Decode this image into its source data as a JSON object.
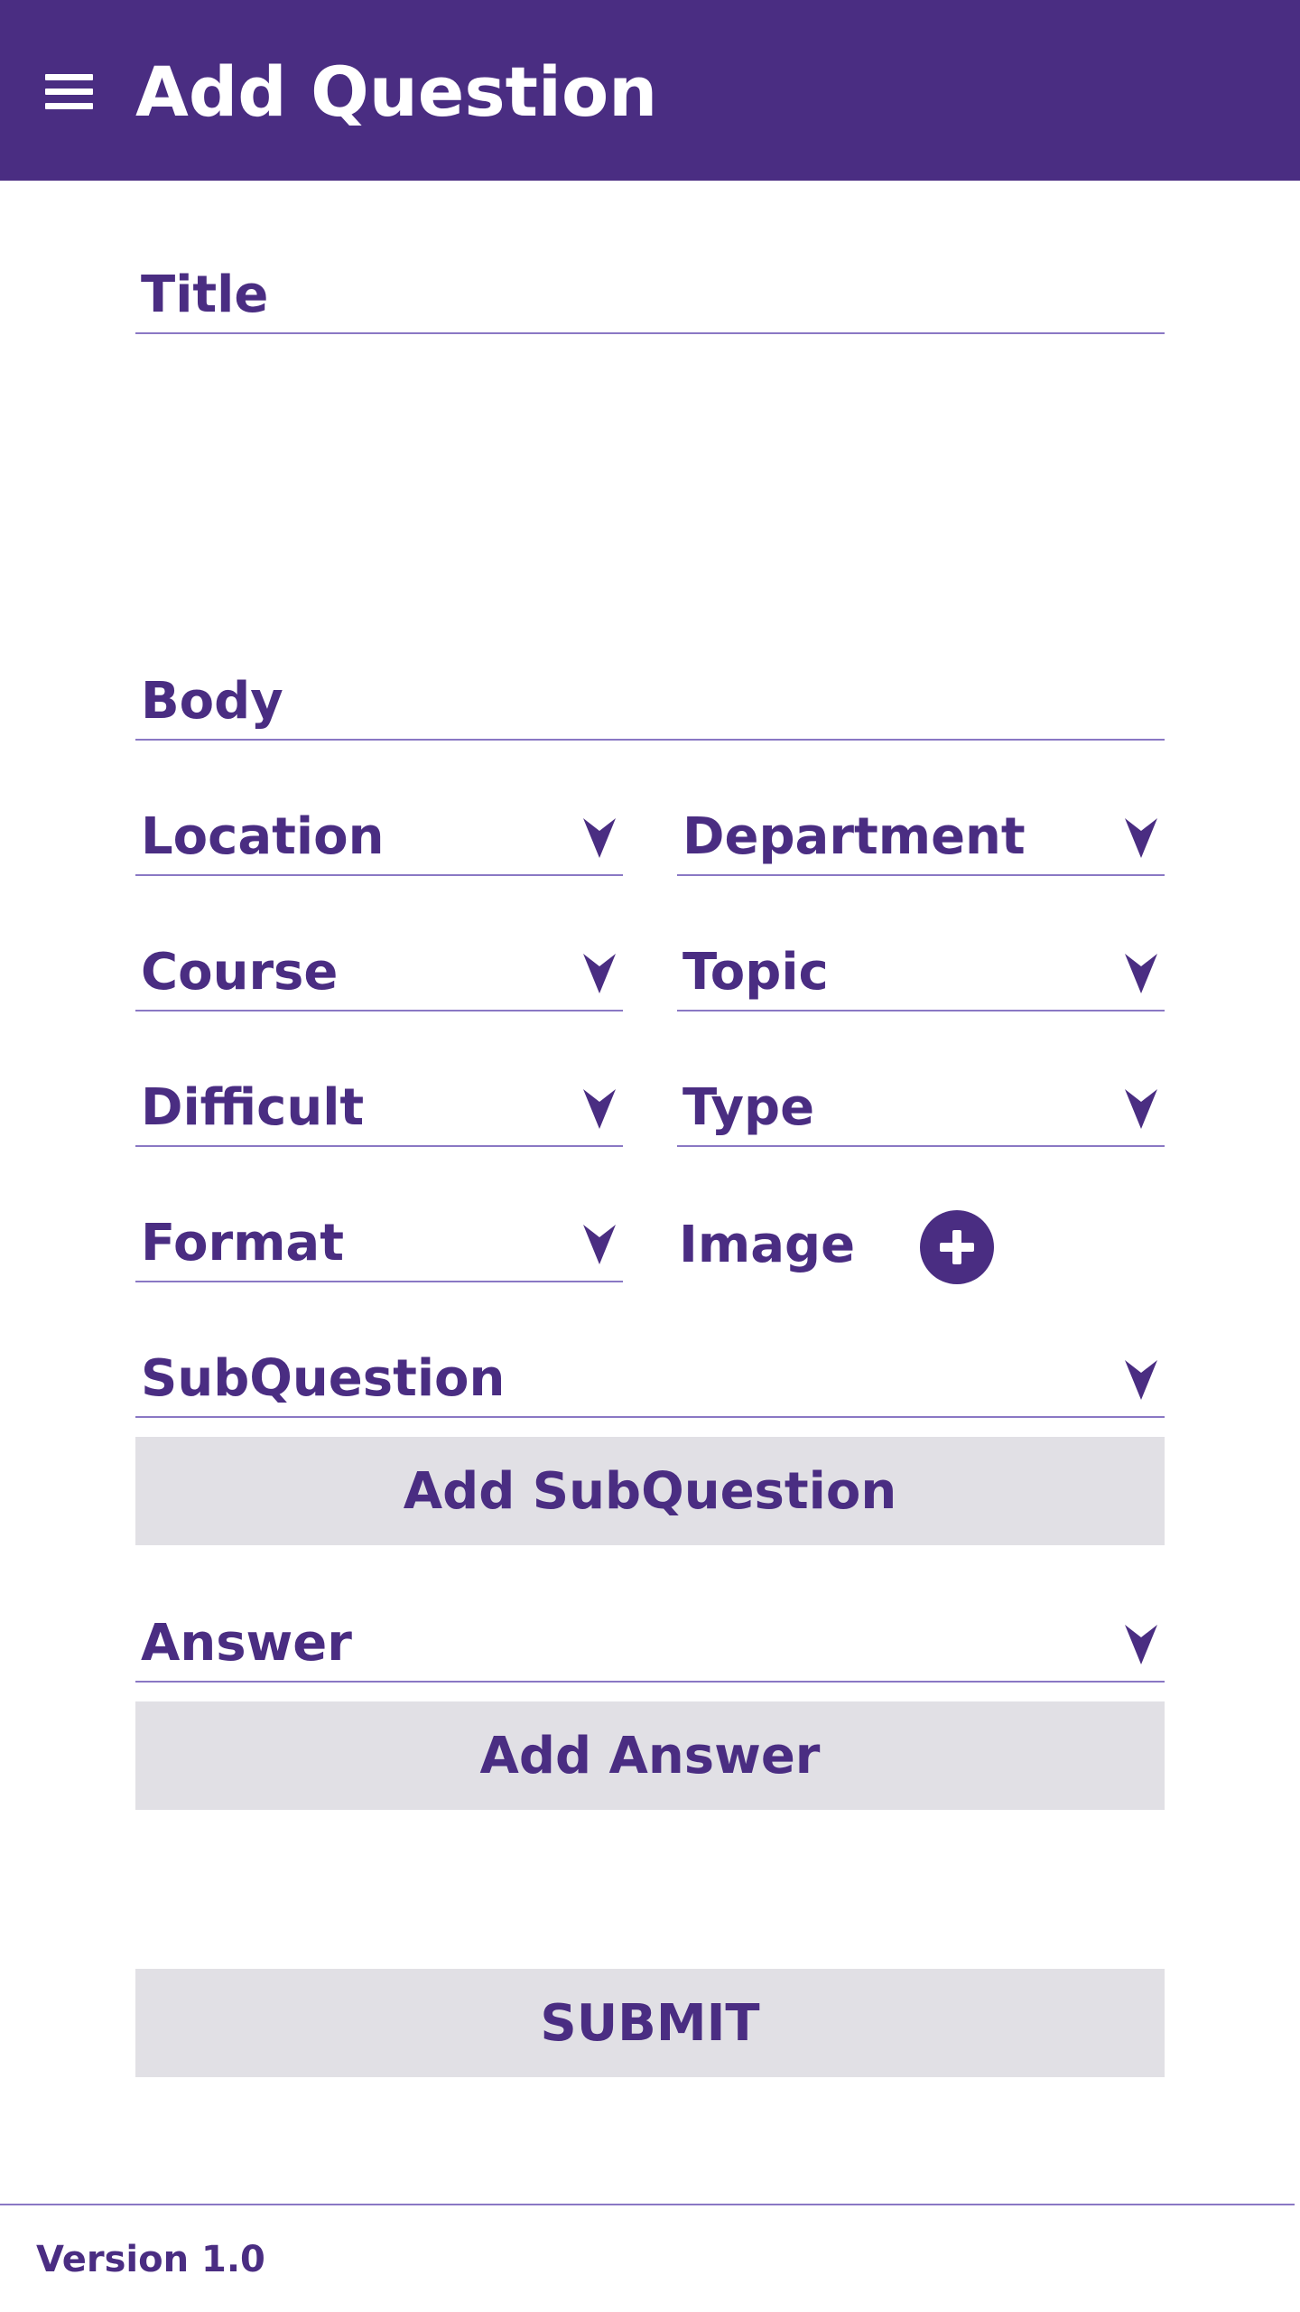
{
  "appbar": {
    "menu_icon": "hamburger-menu-icon",
    "title": "Add Question"
  },
  "form": {
    "title_placeholder": "Title",
    "body_placeholder": "Body",
    "location_label": "Location",
    "department_label": "Department",
    "course_label": "Course",
    "topic_label": "Topic",
    "difficult_label": "Difficult",
    "type_label": "Type",
    "format_label": "Format",
    "image_label": "Image",
    "image_add_icon": "plus-circle-icon",
    "subquestion_label": "SubQuestion",
    "add_subquestion_button": "Add SubQuestion",
    "answer_label": "Answer",
    "add_answer_button": "Add Answer",
    "submit_button": "SUBMIT",
    "dropdown_icon": "caret-down-icon"
  },
  "footer": {
    "version": "Version 1.0"
  },
  "colors": {
    "primary": "#4a2d82",
    "button_bg": "#e1e0e5",
    "divider": "#8a78c4"
  }
}
